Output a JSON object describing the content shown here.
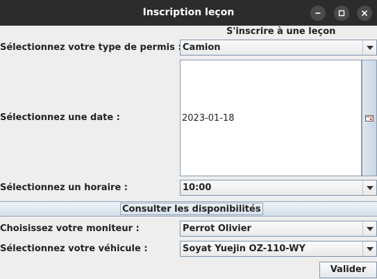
{
  "window": {
    "title": "Inscription leçon"
  },
  "form": {
    "heading": "S'inscrire à une leçon",
    "permis_label": "Sélectionnez votre type de permis :",
    "permis_value": "Camion",
    "date_label": "Sélectionnez une date :",
    "date_value": "2023-01-18",
    "horaire_label": "Sélectionnez un horaire :",
    "horaire_value": "10:00",
    "consult_label": "Consulter les disponibilités",
    "moniteur_label": "Choisissez votre moniteur :",
    "moniteur_value": "Perrot Olivier",
    "vehicule_label": "Sélectionnez votre véhicule :",
    "vehicule_value": "Soyat Yuejin OZ-110-WY",
    "submit_label": "Valider"
  },
  "icons": {
    "minimize": "minimize-icon",
    "maximize": "maximize-icon",
    "close": "close-icon",
    "dropdown": "chevron-down-icon",
    "calendar": "calendar-icon"
  },
  "colors": {
    "titlebar": "#2c2c2c",
    "background": "#eeeeee",
    "border": "#7f93a8"
  }
}
